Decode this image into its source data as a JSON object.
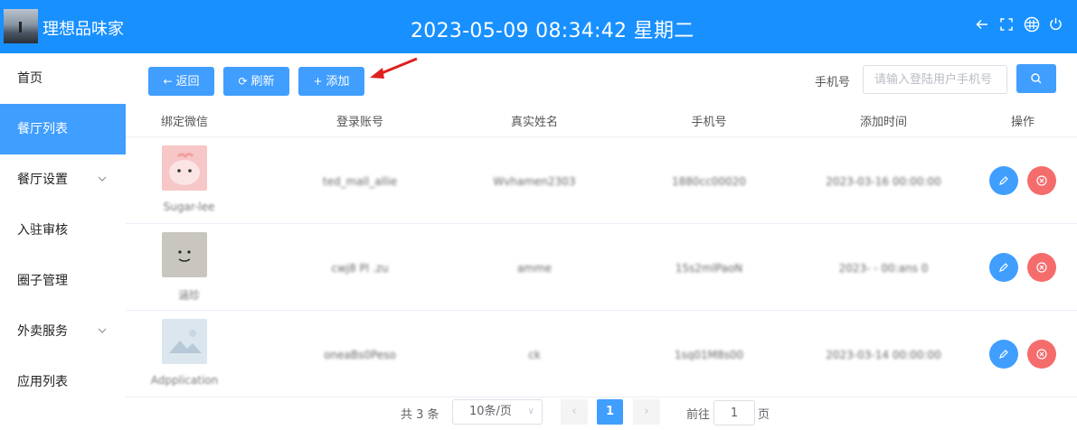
{
  "header": {
    "app_title": "理想品味家",
    "clock": "2023-05-09 08:34:42 星期二",
    "icons": [
      "back-arrow-icon",
      "fullscreen-icon",
      "theme-icon",
      "power-icon"
    ]
  },
  "sidebar": {
    "items": [
      {
        "label": "首页",
        "active": false,
        "has_submenu": false
      },
      {
        "label": "餐厅列表",
        "active": true,
        "has_submenu": false
      },
      {
        "label": "餐厅设置",
        "active": false,
        "has_submenu": true
      },
      {
        "label": "入驻审核",
        "active": false,
        "has_submenu": false
      },
      {
        "label": "圈子管理",
        "active": false,
        "has_submenu": false
      },
      {
        "label": "外卖服务",
        "active": false,
        "has_submenu": true
      },
      {
        "label": "应用列表",
        "active": false,
        "has_submenu": false
      }
    ]
  },
  "toolbar": {
    "back_label": "返回",
    "refresh_label": "刷新",
    "add_label": "添加",
    "search_label": "手机号",
    "search_placeholder": "请输入登陆用户手机号"
  },
  "table": {
    "headers": [
      "绑定微信",
      "登录账号",
      "真实姓名",
      "手机号",
      "添加时间",
      "操作"
    ],
    "rows": [
      {
        "wechat": "Sugar-lee",
        "account": "ted_mall_allie",
        "name": "Wvhamen2303",
        "phone": "1880cc00020",
        "time": "2023-03-16 00:00:00"
      },
      {
        "wechat": "涵珍",
        "account": "cwj8 Pl .zu",
        "name": "amme",
        "phone": "15s2mlPaoN",
        "time": "2023- - 00:ans 0"
      },
      {
        "wechat": "Adpplication",
        "account": "oneaBs0Peso",
        "name": "ck",
        "phone": "1sq01M8s00",
        "time": "2023-03-14 00:00:00"
      }
    ]
  },
  "pagination": {
    "total_label": "共 3 条",
    "page_size_label": "10条/页",
    "current_page": "1",
    "goto_label": "前往",
    "goto_value": "1",
    "page_suffix": "页"
  },
  "colors": {
    "header_bg": "#1890ff",
    "primary": "#409eff",
    "danger": "#f56c6c",
    "annotation_arrow": "#e02020"
  }
}
